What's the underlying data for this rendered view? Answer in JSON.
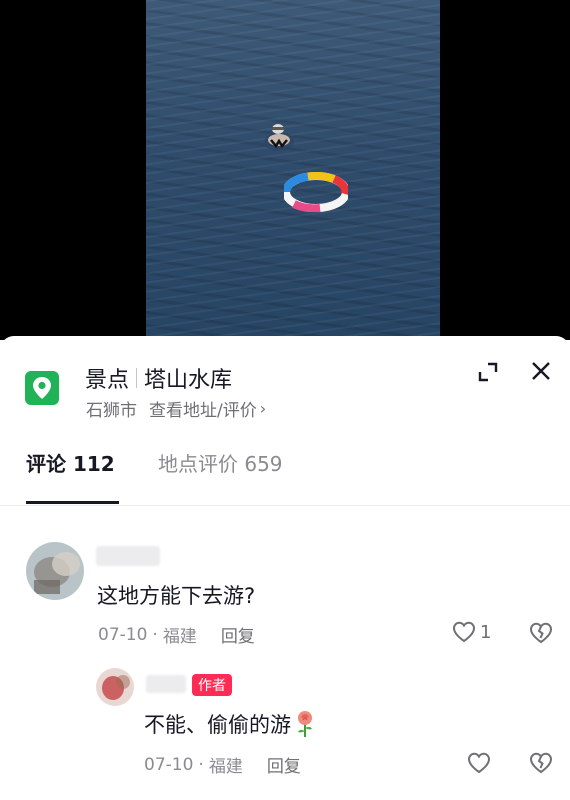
{
  "poi": {
    "category": "景点",
    "name": "塔山水库",
    "city": "石狮市",
    "link_text": "查看地址/评价",
    "chevron": "›",
    "icon": "location-pin-icon",
    "icon_color": "#1fb257"
  },
  "tabs": [
    {
      "label": "评论 112",
      "active": true
    },
    {
      "label": "地点评价 659",
      "active": false
    }
  ],
  "comments": [
    {
      "text": "这地方能下去游?",
      "date": "07-10",
      "separator": "·",
      "location": "福建",
      "reply_label": "回复",
      "like_count": "1"
    }
  ],
  "replies": [
    {
      "badge": "作者",
      "text": "不能、偷偷的游",
      "emoji_icon": "rose-icon",
      "date": "07-10",
      "separator": "·",
      "location": "福建",
      "reply_label": "回复"
    }
  ],
  "colors": {
    "accent": "#fe2c55",
    "text_primary": "#161823",
    "text_secondary": "#8a8b91"
  }
}
